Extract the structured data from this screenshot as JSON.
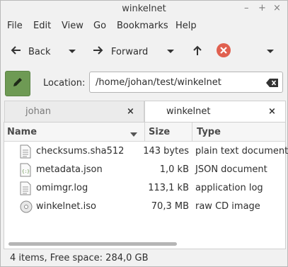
{
  "window": {
    "title": "winkelnet",
    "controls": [
      "–",
      "+",
      "×"
    ]
  },
  "menubar": {
    "items": [
      "File",
      "Edit",
      "View",
      "Go",
      "Bookmarks",
      "Help"
    ]
  },
  "toolbar": {
    "back_label": "Back",
    "forward_label": "Forward"
  },
  "location": {
    "label": "Location:",
    "path": "/home/johan/test/winkelnet"
  },
  "tabs": [
    {
      "label": "johan",
      "active": false
    },
    {
      "label": "winkelnet",
      "active": true
    }
  ],
  "columns": {
    "name": "Name",
    "size": "Size",
    "type": "Type"
  },
  "files": [
    {
      "name": "checksums.sha512",
      "size": "143 bytes",
      "type": "plain text document",
      "icon": "text-file-icon"
    },
    {
      "name": "metadata.json",
      "size": "1,0 kB",
      "type": "JSON document",
      "icon": "json-file-icon"
    },
    {
      "name": "omimgr.log",
      "size": "113,1 kB",
      "type": "application log",
      "icon": "log-file-icon"
    },
    {
      "name": "winkelnet.iso",
      "size": "70,3 MB",
      "type": "raw CD image",
      "icon": "disc-image-icon"
    }
  ],
  "statusbar": {
    "text": "4 items, Free space: 284,0 GB"
  },
  "colors": {
    "edit_button": "#6e9a54",
    "stop_button": "#e0604f",
    "window_bg": "#f1f1f1"
  }
}
